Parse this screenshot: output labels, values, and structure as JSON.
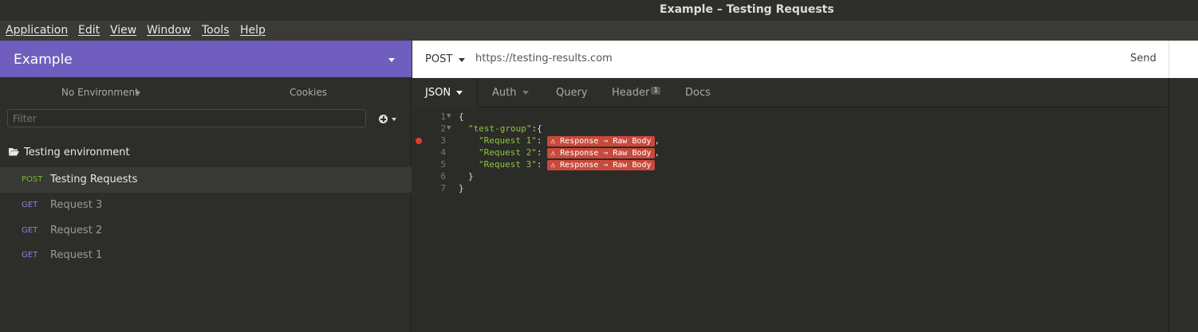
{
  "window": {
    "title": "Example – Testing Requests"
  },
  "menu": [
    "Application",
    "Edit",
    "View",
    "Window",
    "Tools",
    "Help"
  ],
  "sidebar": {
    "workspace": "Example",
    "environment": "No Environment",
    "cookies": "Cookies",
    "filter_placeholder": "Filter",
    "folder": "Testing environment",
    "requests": [
      {
        "method": "POST",
        "name": "Testing Requests"
      },
      {
        "method": "GET",
        "name": "Request 3"
      },
      {
        "method": "GET",
        "name": "Request 2"
      },
      {
        "method": "GET",
        "name": "Request 1"
      }
    ]
  },
  "request": {
    "method": "POST",
    "url": "https://testing-results.com",
    "send": "Send"
  },
  "tabs": {
    "json": "JSON",
    "auth": "Auth",
    "query": "Query",
    "header": "Header",
    "header_count": "1",
    "docs": "Docs"
  },
  "editor": {
    "lines": [
      {
        "num": "1",
        "text": "{"
      },
      {
        "num": "2",
        "key": "\"test-group\"",
        "text": ":{"
      },
      {
        "num": "3",
        "key": "\"Request 1\"",
        "tag": "⚠ Response ⇒ Raw Body",
        "tail": ","
      },
      {
        "num": "4",
        "key": "\"Request 2\"",
        "tag": "⚠ Response ⇒ Raw Body",
        "tail": ","
      },
      {
        "num": "5",
        "key": "\"Request 3\"",
        "tag": "⚠ Response ⇒ Raw Body",
        "tail": ""
      },
      {
        "num": "6",
        "text": "}"
      },
      {
        "num": "7",
        "text": "}"
      }
    ]
  }
}
